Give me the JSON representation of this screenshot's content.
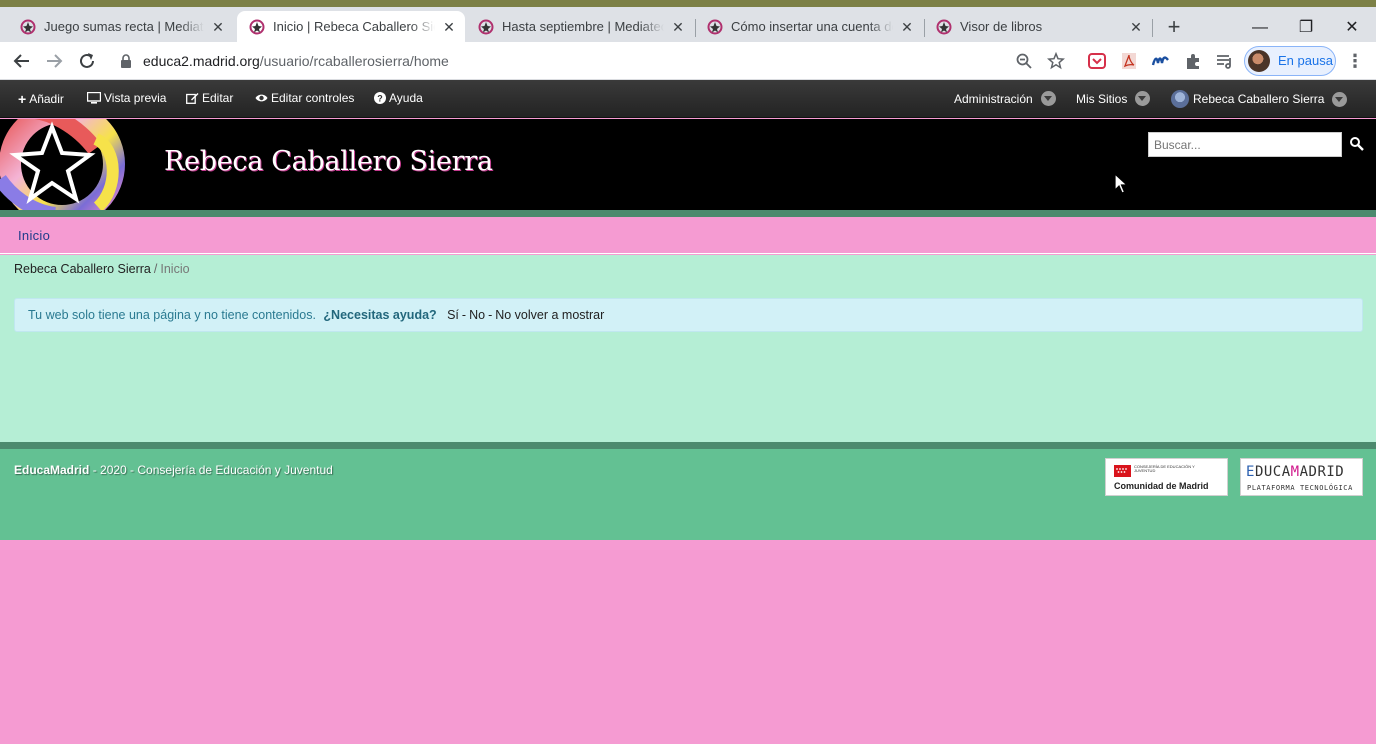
{
  "browser": {
    "tabs": [
      {
        "title": "Juego sumas recta | Mediateca de EducaMadrid",
        "active": false
      },
      {
        "title": "Inicio | Rebeca Caballero Sierra",
        "active": true
      },
      {
        "title": "Hasta septiembre | Mediateca de EducaMadrid",
        "active": false
      },
      {
        "title": "Cómo insertar una cuenta de Twitter",
        "active": false
      },
      {
        "title": "Visor de libros",
        "active": false
      }
    ],
    "url_host": "educa2.madrid.org",
    "url_path": "/usuario/rcaballerosierra/home",
    "profile_label": "En pausa"
  },
  "dockbar": {
    "add": "Añadir",
    "preview": "Vista previa",
    "edit": "Editar",
    "edit_controls": "Editar controles",
    "help": "Ayuda",
    "admin": "Administración",
    "my_sites": "Mis Sitios",
    "user": "Rebeca Caballero Sierra"
  },
  "site": {
    "title": "Rebeca Caballero Sierra",
    "search_placeholder": "Buscar..."
  },
  "nav": {
    "items": [
      {
        "label": "Inicio"
      }
    ]
  },
  "breadcrumb": {
    "site": "Rebeca Caballero Sierra",
    "separator": "/",
    "current": "Inicio"
  },
  "alert": {
    "message": "Tu web solo tiene una página y no tiene contenidos.",
    "question": "¿Necesitas ayuda?",
    "yes": "Sí",
    "no": "No",
    "dont_show": "No volver a mostrar",
    "dash": "-"
  },
  "footer": {
    "brand": "EducaMadrid",
    "text": " - 2020 - Consejería de Educación y Juventud",
    "madrid_small": "CONSEJERÍA DE EDUCACIÓN Y JUVENTUD",
    "madrid_name": "Comunidad de Madrid",
    "educa_e": "E",
    "educa_mid": "DUCA",
    "educa_m": "M",
    "educa_end": "ADRID",
    "educa_sub": "PLATAFORMA TECNOLÓGICA"
  },
  "colors": {
    "site_background": "#f59bd2",
    "content_background": "#b5eed5",
    "footer_background": "#63c193",
    "stripe": "#4c8a6e",
    "header_background": "#000000"
  },
  "icons": {
    "tab_favicon": "educamadrid-favicon",
    "search": "search-icon",
    "lock": "lock-icon"
  }
}
